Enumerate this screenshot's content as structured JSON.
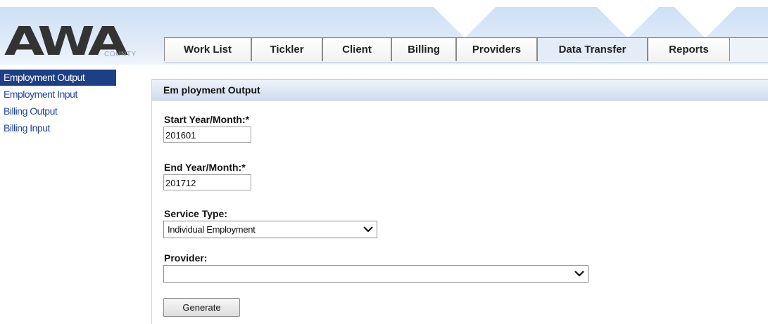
{
  "logo": {
    "text": "AWA",
    "sub": "COUNTY"
  },
  "tabs": [
    {
      "label": "Work List"
    },
    {
      "label": "Tickler"
    },
    {
      "label": "Client"
    },
    {
      "label": "Billing"
    },
    {
      "label": "Providers"
    },
    {
      "label": "Data Transfer",
      "active": true
    },
    {
      "label": "Reports"
    }
  ],
  "sidebar": {
    "items": [
      {
        "label": "Employment Output",
        "active": true
      },
      {
        "label": "Employment Input"
      },
      {
        "label": "Billing Output"
      },
      {
        "label": "Billing Input"
      }
    ]
  },
  "form": {
    "title": "Em ployment Output",
    "start": {
      "label": "Start Year/Month:*",
      "value": "201601"
    },
    "end": {
      "label": "End Year/Month:*",
      "value": "201712"
    },
    "service_type": {
      "label": "Service Type:",
      "value": "Individual Employment"
    },
    "provider": {
      "label": "Provider:",
      "value": ""
    },
    "generate_label": "Generate"
  },
  "colors": {
    "accent": "#1e3f85",
    "link": "#1f43a5",
    "header_band": "#cfe0f6"
  }
}
